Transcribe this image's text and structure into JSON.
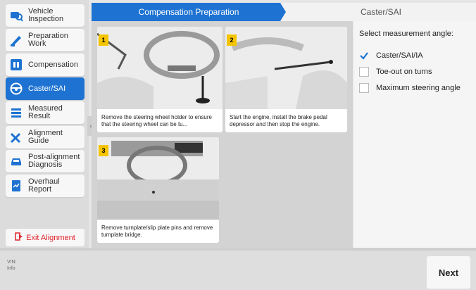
{
  "sidebar": {
    "items": [
      {
        "label": "Vehicle\nInspection",
        "icon": "car-inspection-icon"
      },
      {
        "label": "Preparation\nWork",
        "icon": "tools-icon"
      },
      {
        "label": "Compensation",
        "icon": "compensation-icon"
      },
      {
        "label": "Caster/SAI",
        "icon": "steering-wheel-icon",
        "active": true
      },
      {
        "label": "Measured\nResult",
        "icon": "list-icon"
      },
      {
        "label": "Alignment\nGuide",
        "icon": "wrench-icon"
      },
      {
        "label": "Post-alignment\nDiagnosis",
        "icon": "car-icon"
      },
      {
        "label": "Overhaul Report",
        "icon": "report-icon"
      }
    ],
    "exit_label": "Exit Alignment"
  },
  "steps": {
    "active": "Compensation Preparation",
    "next": "Caster/SAI"
  },
  "cards": [
    {
      "num": "1",
      "caption": "Remove the steering wheel holder to ensure that the steering wheel can be tu..."
    },
    {
      "num": "2",
      "caption": "Start the engine, install the brake pedal depressor and then stop the engine."
    },
    {
      "num": "3",
      "caption": "Remove turnplate/slip plate pins and remove turnplate bridge."
    }
  ],
  "measure": {
    "title": "Select measurement angle:",
    "options": [
      {
        "label": "Caster/SAI/IA",
        "checked": true
      },
      {
        "label": "Toe-out on turns",
        "checked": false
      },
      {
        "label": "Maximum steering angle",
        "checked": false
      }
    ]
  },
  "footer": {
    "vin_label": "VIN:",
    "info_label": "Info",
    "next_label": "Next"
  },
  "colors": {
    "accent": "#1e73d2",
    "exit": "#e0242c",
    "step_badge": "#f5c400"
  }
}
